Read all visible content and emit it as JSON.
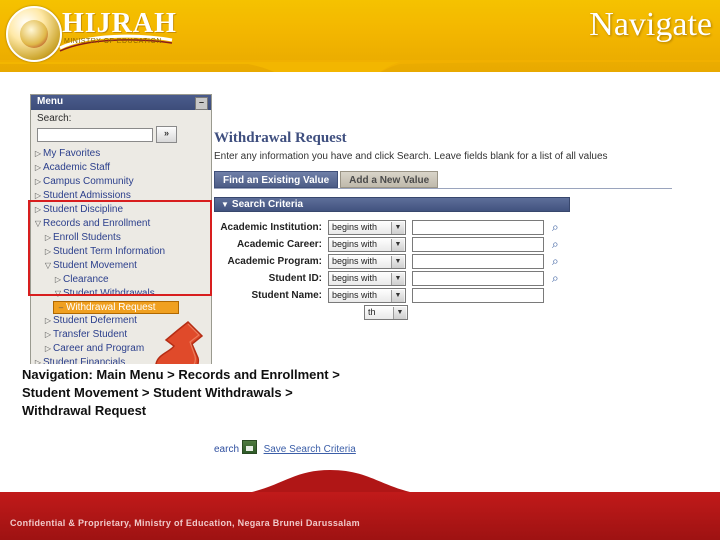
{
  "banner": {
    "title": "Navigate",
    "logo_text": "HIJRAH",
    "logo_sub": "MINISTRY OF EDUCATION"
  },
  "menu_panel": {
    "header": "Menu",
    "collapse_icon": "minimize-icon",
    "search_label": "Search:",
    "search_value": "",
    "search_go": "»",
    "items": [
      {
        "arrow": "▷",
        "label": "My Favorites",
        "indent": 0,
        "selected": false
      },
      {
        "arrow": "▷",
        "label": "Academic Staff",
        "indent": 0,
        "selected": false
      },
      {
        "arrow": "▷",
        "label": "Campus Community",
        "indent": 0,
        "selected": false
      },
      {
        "arrow": "▷",
        "label": "Student Admissions",
        "indent": 0,
        "selected": false
      },
      {
        "arrow": "▷",
        "label": "Student Discipline",
        "indent": 0,
        "selected": false
      },
      {
        "arrow": "▽",
        "label": "Records and Enrollment",
        "indent": 0,
        "selected": false
      },
      {
        "arrow": "▷",
        "label": "Enroll Students",
        "indent": 1,
        "selected": false
      },
      {
        "arrow": "▷",
        "label": "Student Term Information",
        "indent": 1,
        "selected": false
      },
      {
        "arrow": "▽",
        "label": "Student Movement",
        "indent": 1,
        "selected": false
      },
      {
        "arrow": "▷",
        "label": "Clearance",
        "indent": 2,
        "selected": false
      },
      {
        "arrow": "▽",
        "label": "Student Withdrawals",
        "indent": 2,
        "selected": false
      },
      {
        "arrow": "–",
        "label": "Withdrawal Request",
        "indent": 3,
        "selected": true
      },
      {
        "arrow": "▷",
        "label": "Student Deferment",
        "indent": 1,
        "selected": false
      },
      {
        "arrow": "▷",
        "label": "Transfer Student",
        "indent": 1,
        "selected": false
      },
      {
        "arrow": "▷",
        "label": "Career and Program",
        "indent": 1,
        "selected": false
      },
      {
        "arrow": "▷",
        "label": "Student Financials",
        "indent": 0,
        "selected": false
      }
    ]
  },
  "content": {
    "page_title": "Withdrawal Request",
    "instructions": "Enter any information you have and click Search. Leave fields blank for a list of all values",
    "tabs": [
      {
        "label": "Find an Existing Value",
        "active": true
      },
      {
        "label": "Add a New Value",
        "active": false
      }
    ],
    "section_title": "Search Criteria",
    "section_triangle": "▼",
    "criteria": [
      {
        "label": "Academic Institution:",
        "operator": "begins with",
        "value": "",
        "lookup": "magnifier-icon"
      },
      {
        "label": "Academic Career:",
        "operator": "begins with",
        "value": "",
        "lookup": "magnifier-icon"
      },
      {
        "label": "Academic Program:",
        "operator": "begins with",
        "value": "",
        "lookup": "magnifier-icon"
      },
      {
        "label": "Student ID:",
        "operator": "begins with",
        "value": "",
        "lookup": "magnifier-icon"
      },
      {
        "label": "Student Name:",
        "operator": "begins with",
        "value": "",
        "lookup": ""
      },
      {
        "label": "",
        "operator": "th",
        "value": "",
        "lookup": ""
      }
    ],
    "footer": {
      "search_button": "earch",
      "save_link": "Save Search Criteria",
      "save_icon": "save-icon"
    }
  },
  "note": {
    "text": "Navigation: Main Menu > Records and Enrollment > Student Movement > Student Withdrawals > Withdrawal Request"
  },
  "bottom": {
    "text": "Confidential & Proprietary, Ministry of Education, Negara Brunei Darussalam"
  },
  "colors": {
    "banner_yellow": "#f3b600",
    "banner_red": "#b01616",
    "highlight_orange": "#f0a020",
    "red_box": "#d81e1e",
    "ps_blue": "#42537f"
  }
}
